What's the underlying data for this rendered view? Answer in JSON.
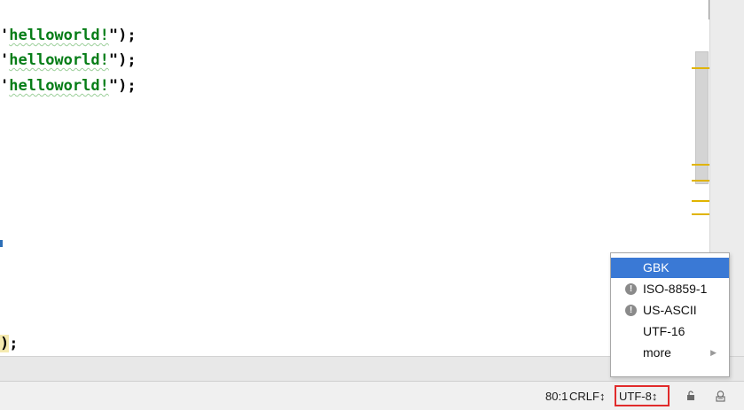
{
  "editor": {
    "lines": [
      {
        "prefix": "'",
        "string": "helloworld!",
        "suffix": "\");"
      },
      {
        "prefix": "'",
        "string": "helloworld!",
        "suffix": "\");"
      },
      {
        "prefix": "'",
        "string": "helloworld!",
        "suffix": "\");"
      }
    ],
    "bottom_line": {
      "paren": ")",
      "rest": ";"
    }
  },
  "status_bar": {
    "position": "80:1",
    "line_separator": "CRLF↕",
    "encoding": "UTF-8↕",
    "icons": [
      "lock-icon",
      "inspector-icon"
    ]
  },
  "encoding_popup": {
    "items": [
      {
        "label": "GBK",
        "selected": true,
        "warning": false
      },
      {
        "label": "ISO-8859-1",
        "selected": false,
        "warning": true
      },
      {
        "label": "US-ASCII",
        "selected": false,
        "warning": true
      },
      {
        "label": "UTF-16",
        "selected": false,
        "warning": false
      },
      {
        "label": "more",
        "selected": false,
        "warning": false,
        "submenu": true
      }
    ]
  },
  "colors": {
    "string": "#067d17",
    "selection": "#3a79d5",
    "marker": "#e0b400",
    "highlight_box": "#e12b2b"
  }
}
